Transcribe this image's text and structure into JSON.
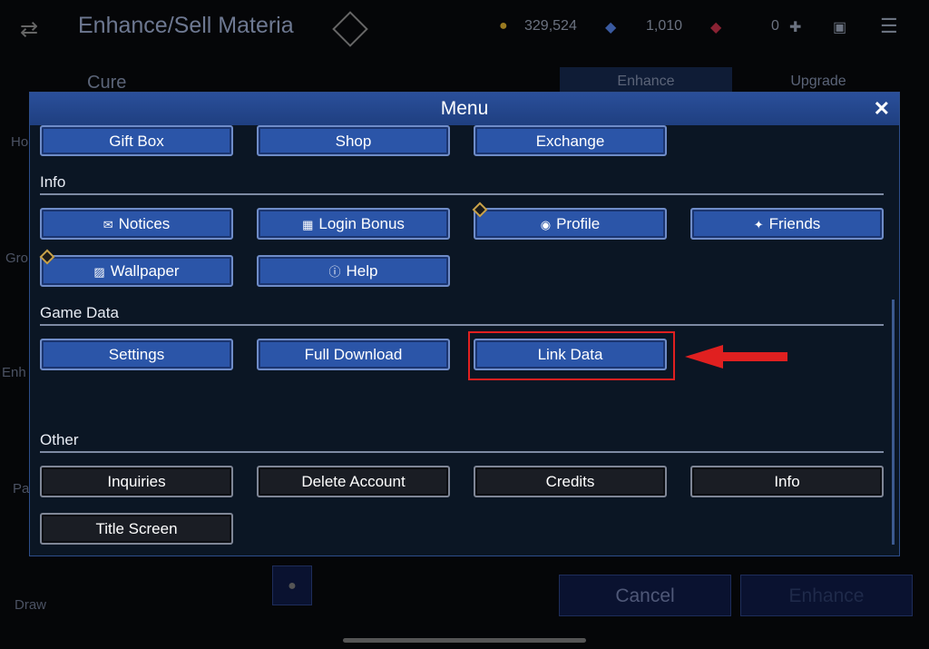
{
  "header": {
    "title": "Enhance/Sell Materia",
    "gil": "329,524",
    "crystals": "1,010",
    "gems": "0"
  },
  "background": {
    "materia_name": "Cure",
    "tabs": [
      "Enhance",
      "Upgrade"
    ],
    "sidebar": [
      "Ho",
      "Gro",
      "Enh",
      "Pa",
      "Draw"
    ],
    "cancel": "Cancel",
    "enhance": "Enhance"
  },
  "menu": {
    "title": "Menu",
    "top_row": [
      "Gift Box",
      "Shop",
      "Exchange"
    ],
    "info_label": "Info",
    "info": [
      "Notices",
      "Login Bonus",
      "Profile",
      "Friends",
      "Wallpaper",
      "Help"
    ],
    "game_data_label": "Game Data",
    "game_data": [
      "Settings",
      "Full Download",
      "Link Data"
    ],
    "other_label": "Other",
    "other": [
      "Inquiries",
      "Delete Account",
      "Credits",
      "Info",
      "Title Screen"
    ]
  },
  "colors": {
    "accent": "#2b55a8",
    "highlight": "#e02020"
  }
}
